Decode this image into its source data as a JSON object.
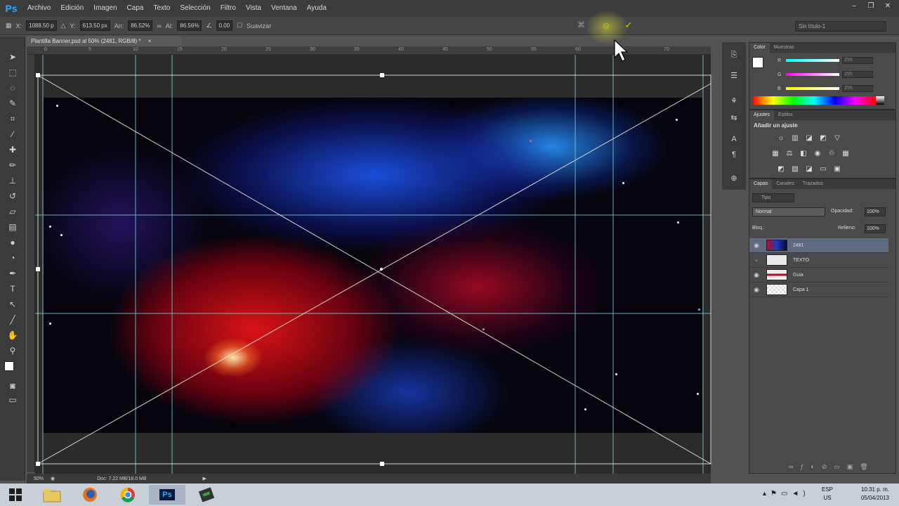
{
  "app": {
    "logo": "Ps"
  },
  "menu": [
    "Archivo",
    "Edición",
    "Imagen",
    "Capa",
    "Texto",
    "Selección",
    "Filtro",
    "Vista",
    "Ventana",
    "Ayuda"
  ],
  "window_controls": {
    "minimize": "–",
    "restore": "❐",
    "close": "✕"
  },
  "options_bar": {
    "x_label": "X:",
    "x_value": "1088.50 p",
    "y_label": "Y:",
    "y_value": "613.50 px",
    "w_label": "An:",
    "w_value": "86.52%",
    "h_label": "Al:",
    "h_value": "86.56%",
    "angle_value": "0.00",
    "smooth_label": "Suavizar",
    "cancel_icon": "⦸",
    "commit_icon": "✓",
    "workspace": "Sin título-1"
  },
  "document": {
    "tab_title": "Plantilla Banner.psd al 50% (2481, RGB/8) *",
    "close_icon": "×",
    "zoom": "50%",
    "doc_size": "Doc: 7.22 MB/18.0 MB"
  },
  "ruler_ticks": [
    "0",
    "5",
    "10",
    "15",
    "20",
    "25",
    "30",
    "35",
    "40",
    "45",
    "50",
    "55",
    "60",
    "65",
    "70"
  ],
  "tools": [
    "move-tool",
    "marquee-tool",
    "lasso-tool",
    "quick-select-tool",
    "crop-tool",
    "eyedropper-tool",
    "healing-tool",
    "brush-tool",
    "stamp-tool",
    "history-brush-tool",
    "eraser-tool",
    "gradient-tool",
    "blur-tool",
    "dodge-tool",
    "pen-tool",
    "type-tool",
    "path-select-tool",
    "shape-tool",
    "hand-tool",
    "zoom-tool"
  ],
  "color_panel": {
    "tabs": [
      "Color",
      "Muestras"
    ],
    "r_label": "R",
    "r_value": "255",
    "g_label": "G",
    "g_value": "255",
    "b_label": "B",
    "b_value": "255"
  },
  "adjustments_panel": {
    "tabs": [
      "Ajustes",
      "Estilos"
    ],
    "title": "Añadir un ajuste"
  },
  "layers_panel": {
    "tabs": [
      "Capas",
      "Canales",
      "Trazados"
    ],
    "filter_label": "Tipo",
    "blend_mode": "Normal",
    "opacity_label": "Opacidad:",
    "opacity_value": "100%",
    "lock_label": "Bloq.:",
    "fill_label": "Relleno:",
    "fill_value": "100%",
    "layers": [
      {
        "name": "2481",
        "selected": true
      },
      {
        "name": "TEXTO",
        "selected": false
      },
      {
        "name": "Guia",
        "selected": false
      },
      {
        "name": "Capa 1",
        "selected": false
      }
    ]
  },
  "taskbar": {
    "lang": "ESP",
    "lang_sub": "US",
    "time": "10:31 p. m.",
    "date": "05/04/2013",
    "apps": [
      "start-button",
      "file-explorer",
      "firefox",
      "chrome",
      "photoshop",
      "other-app"
    ],
    "ps_label": "Ps"
  },
  "colors": {
    "accent_yellow": "#c9d100",
    "guide": "#6fd0d8",
    "selection": "#5e6a80"
  }
}
